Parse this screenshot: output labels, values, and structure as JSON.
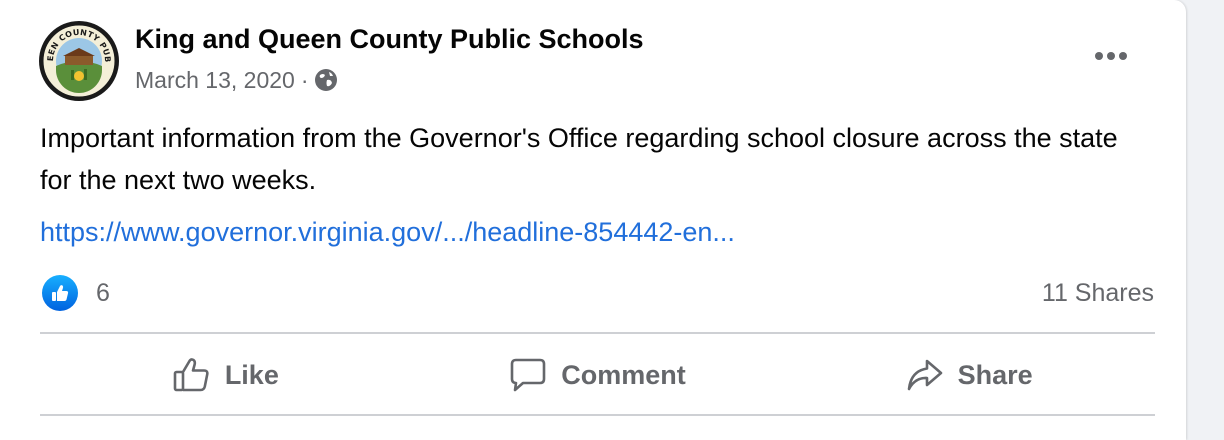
{
  "post": {
    "author": "King and Queen County Public Schools",
    "avatar_icon": "school-seal-logo",
    "avatar_seal_text": "KING AND QUEEN COUNTY PUBLIC SCHOOLS",
    "date": "March 13, 2020",
    "separator": "·",
    "audience_icon": "globe-icon",
    "more_icon": "more-options-icon",
    "text": "Important information from the Governor's Office regarding school closure across the state for the next two weeks.",
    "link": "https://www.governor.virginia.gov/.../headline-854442-en..."
  },
  "stats": {
    "reaction_icon": "like-reaction-icon",
    "reactions": "6",
    "shares": "11 Shares"
  },
  "actions": {
    "like": "Like",
    "comment": "Comment",
    "share": "Share"
  },
  "colors": {
    "link": "#216fdb",
    "secondary_text": "#65676b",
    "like_blue": "#1877f2"
  }
}
